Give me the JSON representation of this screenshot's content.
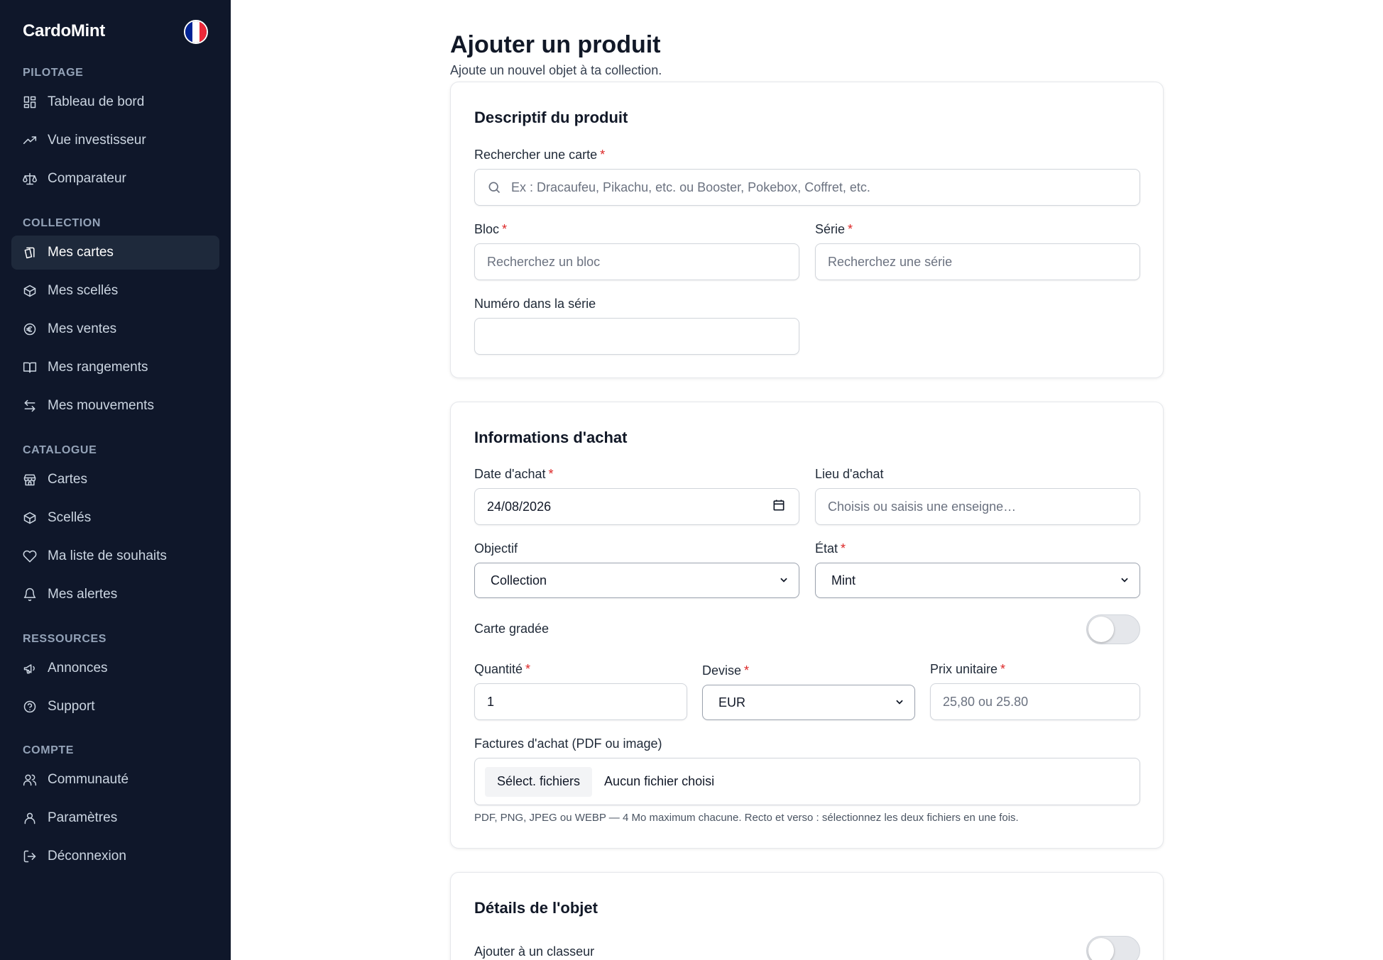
{
  "app": {
    "name": "CardoMint",
    "flag_colors": [
      "#002395",
      "#ffffff",
      "#ed2939"
    ]
  },
  "sidebar": {
    "sections": [
      {
        "title": "PILOTAGE",
        "items": [
          {
            "label": "Tableau de bord",
            "icon": "dashboard-icon"
          },
          {
            "label": "Vue investisseur",
            "icon": "trending-up-icon"
          },
          {
            "label": "Comparateur",
            "icon": "scale-icon"
          }
        ]
      },
      {
        "title": "COLLECTION",
        "items": [
          {
            "label": "Mes cartes",
            "icon": "cards-icon",
            "active": true
          },
          {
            "label": "Mes scellés",
            "icon": "box-icon"
          },
          {
            "label": "Mes ventes",
            "icon": "euro-icon"
          },
          {
            "label": "Mes rangements",
            "icon": "book-icon"
          },
          {
            "label": "Mes mouvements",
            "icon": "arrows-icon"
          }
        ]
      },
      {
        "title": "CATALOGUE",
        "items": [
          {
            "label": "Cartes",
            "icon": "store-icon"
          },
          {
            "label": "Scellés",
            "icon": "box-icon"
          },
          {
            "label": "Ma liste de souhaits",
            "icon": "heart-icon"
          },
          {
            "label": "Mes alertes",
            "icon": "bell-icon"
          }
        ]
      },
      {
        "title": "RESSOURCES",
        "items": [
          {
            "label": "Annonces",
            "icon": "megaphone-icon"
          },
          {
            "label": "Support",
            "icon": "help-icon"
          }
        ]
      },
      {
        "title": "COMPTE",
        "items": [
          {
            "label": "Communauté",
            "icon": "users-icon"
          },
          {
            "label": "Paramètres",
            "icon": "user-icon"
          },
          {
            "label": "Déconnexion",
            "icon": "logout-icon"
          }
        ]
      }
    ]
  },
  "page": {
    "title": "Ajouter un produit",
    "subtitle": "Ajoute un nouvel objet à ta collection."
  },
  "descriptif": {
    "title": "Descriptif du produit",
    "search_label": "Rechercher une carte",
    "search_placeholder": "Ex : Dracaufeu, Pikachu, etc. ou Booster, Pokebox, Coffret, etc.",
    "bloc_label": "Bloc",
    "bloc_placeholder": "Recherchez un bloc",
    "serie_label": "Série",
    "serie_placeholder": "Recherchez une série",
    "numero_label": "Numéro dans la série",
    "numero_value": ""
  },
  "achat": {
    "title": "Informations d'achat",
    "date_label": "Date d'achat",
    "date_value": "24/08/2026",
    "lieu_label": "Lieu d'achat",
    "lieu_placeholder": "Choisis ou saisis une enseigne…",
    "objectif_label": "Objectif",
    "objectif_value": "Collection",
    "etat_label": "État",
    "etat_value": "Mint",
    "gradee_label": "Carte gradée",
    "gradee_on": false,
    "quantite_label": "Quantité",
    "quantite_value": "1",
    "devise_label": "Devise",
    "devise_value": "EUR",
    "prix_label": "Prix unitaire",
    "prix_placeholder": "25,80 ou 25.80",
    "factures_label": "Factures d'achat (PDF ou image)",
    "file_button": "Sélect. fichiers",
    "file_status": "Aucun fichier choisi",
    "file_hint": "PDF, PNG, JPEG ou WEBP — 4 Mo maximum chacune. Recto et verso : sélectionnez les deux fichiers en une fois."
  },
  "details": {
    "title": "Détails de l'objet",
    "classeur_label": "Ajouter à un classeur",
    "classeur_on": false
  },
  "required_mark": "*"
}
